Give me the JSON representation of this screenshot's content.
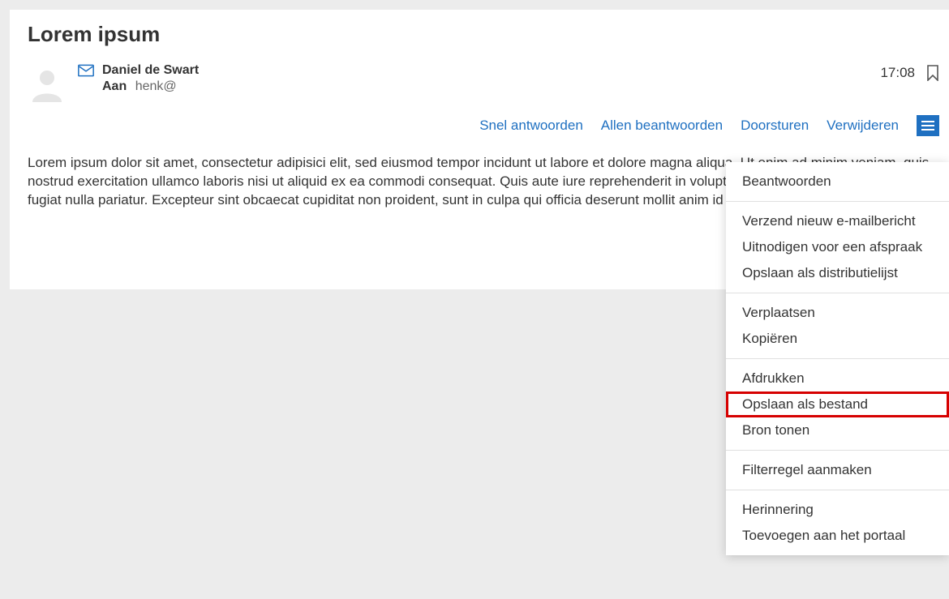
{
  "subject": "Lorem ipsum",
  "sender": {
    "name": "Daniel de Swart",
    "to_label": "Aan",
    "to_value": "henk@"
  },
  "meta": {
    "time": "17:08"
  },
  "actions": {
    "quick_reply": "Snel antwoorden",
    "reply_all": "Allen beantwoorden",
    "forward": "Doorsturen",
    "delete": "Verwijderen"
  },
  "body_text": "Lorem ipsum dolor sit amet, consectetur adipisici elit, sed eiusmod tempor incidunt ut labore et dolore magna aliqua. Ut enim ad minim veniam, quis nostrud exercitation ullamco laboris nisi ut aliquid ex ea commodi consequat. Quis aute iure reprehenderit in voluptate velit esse cillum dolore eu fugiat nulla pariatur. Excepteur sint obcaecat cupiditat non proident, sunt in culpa qui officia deserunt mollit anim id est laborum.",
  "dropdown": {
    "groups": [
      {
        "items": [
          {
            "label": "Beantwoorden"
          }
        ]
      },
      {
        "items": [
          {
            "label": "Verzend nieuw e-mailbericht"
          },
          {
            "label": "Uitnodigen voor een afspraak"
          },
          {
            "label": "Opslaan als distributielijst"
          }
        ]
      },
      {
        "items": [
          {
            "label": "Verplaatsen"
          },
          {
            "label": "Kopiëren"
          }
        ]
      },
      {
        "items": [
          {
            "label": "Afdrukken"
          },
          {
            "label": "Opslaan als bestand",
            "highlighted": true
          },
          {
            "label": "Bron tonen"
          }
        ]
      },
      {
        "items": [
          {
            "label": "Filterregel aanmaken"
          }
        ]
      },
      {
        "items": [
          {
            "label": "Herinnering"
          },
          {
            "label": "Toevoegen aan het portaal"
          }
        ]
      }
    ]
  }
}
